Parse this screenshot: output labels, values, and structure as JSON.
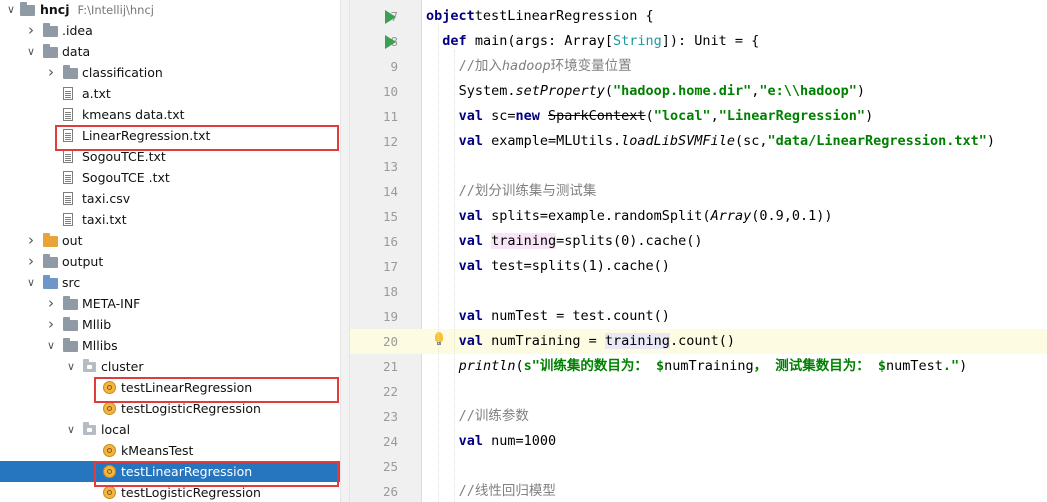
{
  "project": {
    "name": "hncj",
    "path": "F:\\Intellij\\hncj"
  },
  "tree": [
    {
      "label": "hncj",
      "sub": "F:\\Intellij\\hncj",
      "depth": 0,
      "icon": "folder",
      "arrow": "down",
      "bold": true
    },
    {
      "label": ".idea",
      "depth": 1,
      "icon": "folder",
      "arrow": "right"
    },
    {
      "label": "data",
      "depth": 1,
      "icon": "folder",
      "arrow": "down"
    },
    {
      "label": "classification",
      "depth": 2,
      "icon": "folder",
      "arrow": "right"
    },
    {
      "label": "a.txt",
      "depth": 2,
      "icon": "file"
    },
    {
      "label": "kmeans data.txt",
      "depth": 2,
      "icon": "file"
    },
    {
      "label": "LinearRegression.txt",
      "depth": 2,
      "icon": "file",
      "highlighted": true
    },
    {
      "label": "SogouTCE.txt",
      "depth": 2,
      "icon": "file"
    },
    {
      "label": "SogouTCE .txt",
      "depth": 2,
      "icon": "file"
    },
    {
      "label": "taxi.csv",
      "depth": 2,
      "icon": "file"
    },
    {
      "label": "taxi.txt",
      "depth": 2,
      "icon": "file"
    },
    {
      "label": "out",
      "depth": 1,
      "icon": "folder-orange",
      "arrow": "right"
    },
    {
      "label": "output",
      "depth": 1,
      "icon": "folder",
      "arrow": "right"
    },
    {
      "label": "src",
      "depth": 1,
      "icon": "folder-src",
      "arrow": "down"
    },
    {
      "label": "META-INF",
      "depth": 2,
      "icon": "folder",
      "arrow": "right"
    },
    {
      "label": "Mllib",
      "depth": 2,
      "icon": "folder",
      "arrow": "right"
    },
    {
      "label": "Mllibs",
      "depth": 2,
      "icon": "folder",
      "arrow": "down"
    },
    {
      "label": "cluster",
      "depth": 3,
      "icon": "package",
      "arrow": "down"
    },
    {
      "label": "testLinearRegression",
      "depth": 4,
      "icon": "object",
      "highlighted": true
    },
    {
      "label": "testLogisticRegression",
      "depth": 4,
      "icon": "object"
    },
    {
      "label": "local",
      "depth": 3,
      "icon": "package",
      "arrow": "down"
    },
    {
      "label": "kMeansTest",
      "depth": 4,
      "icon": "object"
    },
    {
      "label": "testLinearRegression",
      "depth": 4,
      "icon": "object",
      "highlighted": true,
      "selected": true
    },
    {
      "label": "testLogisticRegression",
      "depth": 4,
      "icon": "object"
    }
  ],
  "editor": {
    "current_line": "20",
    "lines": [
      {
        "n": "7",
        "run": true,
        "indent": 0,
        "tokens": [
          [
            "k",
            "object"
          ],
          [
            "",
            "testLinearRegression {"
          ]
        ]
      },
      {
        "n": "8",
        "run": true,
        "indent": 2,
        "tokens": [
          [
            "k",
            "def"
          ],
          [
            "",
            " main(args: Array["
          ],
          [
            "ty",
            "String"
          ],
          [
            "",
            "]): Unit = {"
          ]
        ]
      },
      {
        "n": "9",
        "indent": 4,
        "tokens": [
          [
            "c",
            "//加入"
          ],
          [
            "ci",
            "hadoop"
          ],
          [
            "c",
            "环境变量位置"
          ]
        ]
      },
      {
        "n": "10",
        "indent": 4,
        "tokens": [
          [
            "",
            "System."
          ],
          [
            "i",
            "setProperty"
          ],
          [
            "",
            "("
          ],
          [
            "s",
            "\"hadoop.home.dir\""
          ],
          [
            "",
            ","
          ],
          [
            "s",
            "\"e:\\\\hadoop\""
          ],
          [
            "",
            ")"
          ]
        ]
      },
      {
        "n": "11",
        "indent": 4,
        "tokens": [
          [
            "k",
            "val"
          ],
          [
            "",
            " sc="
          ],
          [
            "k",
            "new"
          ],
          [
            "",
            " "
          ],
          [
            "strike",
            "SparkContext"
          ],
          [
            "",
            "("
          ],
          [
            "s",
            "\"local\""
          ],
          [
            "",
            ","
          ],
          [
            "s",
            "\"LinearRegression\""
          ],
          [
            "",
            ")"
          ]
        ]
      },
      {
        "n": "12",
        "indent": 4,
        "tokens": [
          [
            "k",
            "val"
          ],
          [
            "",
            " example=MLUtils."
          ],
          [
            "i",
            "loadLibSVMFile"
          ],
          [
            "",
            "(sc,"
          ],
          [
            "s",
            "\"data/LinearRegression.txt\""
          ],
          [
            "",
            ")"
          ]
        ]
      },
      {
        "n": "13",
        "indent": 4,
        "tokens": []
      },
      {
        "n": "14",
        "indent": 4,
        "tokens": [
          [
            "c",
            "//划分训练集与测试集"
          ]
        ]
      },
      {
        "n": "15",
        "indent": 4,
        "tokens": [
          [
            "k",
            "val"
          ],
          [
            "",
            " splits=example.randomSplit("
          ],
          [
            "i",
            "Array"
          ],
          [
            "",
            "(0.9,0.1))"
          ]
        ]
      },
      {
        "n": "16",
        "indent": 4,
        "tokens": [
          [
            "k",
            "val"
          ],
          [
            "",
            " "
          ],
          [
            "mk1",
            "training"
          ],
          [
            "",
            "=splits(0).cache()"
          ]
        ]
      },
      {
        "n": "17",
        "indent": 4,
        "tokens": [
          [
            "k",
            "val"
          ],
          [
            "",
            " test=splits(1).cache()"
          ]
        ]
      },
      {
        "n": "18",
        "indent": 4,
        "tokens": []
      },
      {
        "n": "19",
        "indent": 4,
        "tokens": [
          [
            "k",
            "val"
          ],
          [
            "",
            " numTest = test.count()"
          ]
        ]
      },
      {
        "n": "20",
        "indent": 4,
        "bulb": true,
        "tokens": [
          [
            "k",
            "val"
          ],
          [
            "",
            " numTraining = "
          ],
          [
            "mk2",
            "training"
          ],
          [
            "",
            ".count()"
          ]
        ]
      },
      {
        "n": "21",
        "indent": 4,
        "tokens": [
          [
            "i",
            "println"
          ],
          [
            "",
            "("
          ],
          [
            "dl",
            "s\"训练集的数目为： "
          ],
          [
            "s",
            "$"
          ],
          [
            "",
            "numTraining"
          ],
          [
            "dl",
            "， 测试集数目为： "
          ],
          [
            "s",
            "$"
          ],
          [
            "",
            "numTest"
          ],
          [
            "dl",
            "."
          ],
          [
            "s",
            "\""
          ],
          [
            "",
            ")"
          ]
        ]
      },
      {
        "n": "22",
        "indent": 4,
        "tokens": []
      },
      {
        "n": "23",
        "indent": 4,
        "tokens": [
          [
            "c",
            "//训练参数"
          ]
        ]
      },
      {
        "n": "24",
        "indent": 4,
        "tokens": [
          [
            "k",
            "val"
          ],
          [
            "",
            " num=1000"
          ]
        ]
      },
      {
        "n": "25",
        "indent": 4,
        "tokens": []
      },
      {
        "n": "26",
        "indent": 4,
        "tokens": [
          [
            "c",
            "//线性回归模型"
          ]
        ]
      }
    ]
  },
  "colors": {
    "selection": "#2675bf",
    "highlight_box": "#e03c3c",
    "run_icon": "#3ba050"
  }
}
